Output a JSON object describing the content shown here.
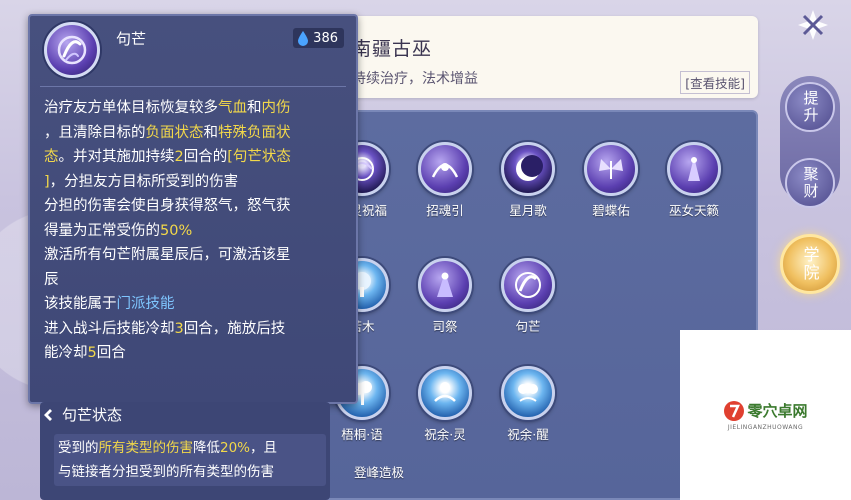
{
  "header": {
    "title": "南疆古巫",
    "subtitle": "持续治疗，法术增益",
    "view_skill_label": "[查看技能]"
  },
  "skills": [
    {
      "label": "生灵祝福",
      "icon": "swirl-spirit-icon",
      "style": "icon-dark"
    },
    {
      "label": "招魂引",
      "icon": "summon-soul-icon",
      "style": "icon-purple"
    },
    {
      "label": "星月歌",
      "icon": "crescent-moon-icon",
      "style": "icon-dark"
    },
    {
      "label": "碧蝶佑",
      "icon": "butterfly-icon",
      "style": "icon-purple"
    },
    {
      "label": "巫女天籁",
      "icon": "shaman-maiden-icon",
      "style": "icon-purple"
    },
    {
      "label": "若木",
      "icon": "tree-icon",
      "style": "icon-blue"
    },
    {
      "label": "司祭",
      "icon": "priest-icon",
      "style": "icon-purple"
    },
    {
      "label": "句芒",
      "icon": "jumang-icon",
      "style": "icon-purple"
    },
    {
      "label": "梧桐·语",
      "icon": "wutong-tree-icon",
      "style": "icon-blue"
    },
    {
      "label": "祝余·灵",
      "icon": "herb-spirit-icon",
      "style": "icon-blue"
    },
    {
      "label": "祝余·醒",
      "icon": "herb-awaken-icon",
      "style": "icon-blue"
    }
  ],
  "partial_label": "登峰造极",
  "side_nav": {
    "close_icon": "close-x-icon",
    "items": [
      {
        "label": "提升"
      },
      {
        "label": "聚财"
      },
      {
        "label": "学院",
        "active": true
      }
    ]
  },
  "tooltip": {
    "name": "句芒",
    "cost": "386",
    "cost_icon": "water-drop-icon",
    "lines": [
      [
        {
          "t": "治疗友方单体目标恢复较多"
        },
        {
          "t": "气血",
          "c": "hl-y"
        },
        {
          "t": "和"
        },
        {
          "t": "内伤",
          "c": "hl-y"
        }
      ],
      [
        {
          "t": "，且清除目标的"
        },
        {
          "t": "负面状态",
          "c": "hl-y"
        },
        {
          "t": "和"
        },
        {
          "t": "特殊负面状",
          "c": "hl-y"
        }
      ],
      [
        {
          "t": "态",
          "c": "hl-y"
        },
        {
          "t": "。并对其施加持续"
        },
        {
          "t": "2",
          "c": "hl-y"
        },
        {
          "t": "回合的"
        },
        {
          "t": "[句芒状态",
          "c": "hl-y"
        }
      ],
      [
        {
          "t": "]",
          "c": "hl-y"
        },
        {
          "t": "，分担友方目标所受到的伤害"
        }
      ],
      [
        {
          "t": "分担的伤害会使自身获得怒气，怒气获"
        }
      ],
      [
        {
          "t": "得量为正常受伤的"
        },
        {
          "t": "50%",
          "c": "hl-y"
        }
      ],
      [
        {
          "t": "激活所有句芒附属星辰后，可激活该星"
        }
      ],
      [
        {
          "t": "辰"
        }
      ],
      [
        {
          "t": "该技能属于"
        },
        {
          "t": "门派技能",
          "c": "hl-b"
        }
      ],
      [
        {
          "t": "进入战斗后技能冷却"
        },
        {
          "t": "3",
          "c": "hl-y"
        },
        {
          "t": "回合，施放后技"
        }
      ],
      [
        {
          "t": "能冷却"
        },
        {
          "t": "5",
          "c": "hl-y"
        },
        {
          "t": "回合"
        }
      ]
    ]
  },
  "status": {
    "title": "句芒状态",
    "lines": [
      [
        {
          "t": "受到的"
        },
        {
          "t": "所有类型的伤害",
          "c": "hl-y"
        },
        {
          "t": "降低"
        },
        {
          "t": "20%",
          "c": "hl-y"
        },
        {
          "t": "，且"
        }
      ],
      [
        {
          "t": "与链接者分担受到的所有类型的伤害"
        }
      ]
    ]
  },
  "watermark": {
    "main": "零穴卓网",
    "sub": "JIELINGANZHUOWANG"
  },
  "colors": {
    "highlight_yellow": "#f2d84a",
    "highlight_blue": "#7fc6ff",
    "panel_blue": "#5d6ca0",
    "tooltip_bg": "#47507e"
  }
}
